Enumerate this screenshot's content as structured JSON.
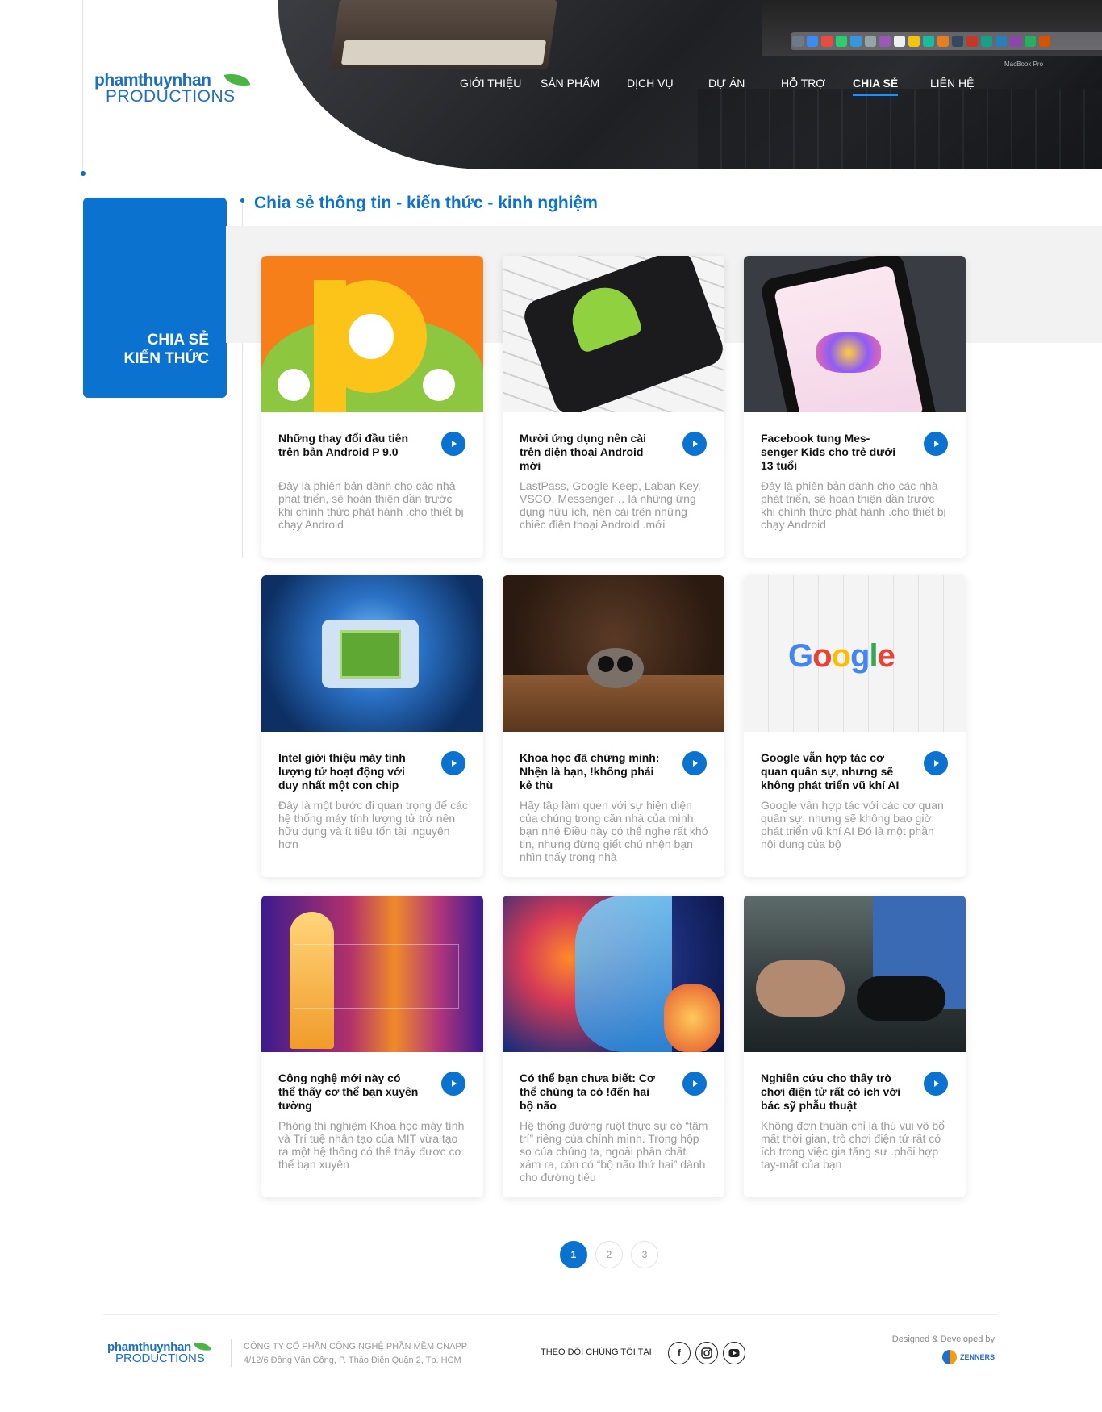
{
  "brand": {
    "logo_line1": "phamthuynhan",
    "logo_line2": "PRODUCTIONS"
  },
  "hero": {
    "device_label": "MacBook Pro"
  },
  "nav": {
    "items": [
      {
        "label": "GIỚI THIỆU"
      },
      {
        "label": "SẢN PHẨM"
      },
      {
        "label": "DỊCH VỤ"
      },
      {
        "label": "DỰ ÁN"
      },
      {
        "label": "HỖ TRỢ"
      },
      {
        "label": "CHIA SẺ",
        "active": true
      },
      {
        "label": "LIÊN HỆ"
      }
    ]
  },
  "sidebar": {
    "line1": "CHIA SẺ",
    "line2": "KIẾN THỨC"
  },
  "section": {
    "title": "Chia sẻ thông tin - kiến thức - kinh nghiệm"
  },
  "articles": [
    {
      "title": "Những thay đổi đầu tiên trên bản Android P 9.0",
      "desc": "Đây là phiên bản dành cho các nhà phát triển, sẽ hoàn thiện dần trước khi chính thức phát hành .cho thiết bị chạy Android",
      "image": "android-pie-image"
    },
    {
      "title": "Mười ứng dụng nên cài trên điện thoại Android mới",
      "desc": "LastPass, Google Keep, Laban Key, VSCO, Messenger… là những ứng dụng hữu ích, nên cài trên những chiếc điện thoại Android .mới",
      "image": "android-phone-image"
    },
    {
      "title": "Facebook tung Mes-senger Kids cho trẻ dưới 13 tuổi",
      "desc": "Đây là phiên bản dành cho các nhà phát triển, sẽ hoàn thiện dần trước khi chính thức phát hành .cho thiết bị chạy Android",
      "image": "messenger-kids-image"
    },
    {
      "title": "Intel giới thiệu máy tính lượng tử hoạt động với duy nhất một con chip",
      "desc": "Đây là một bước đi quan trọng để các hệ thống máy tính lượng tử trở nên hữu dụng và ít tiêu tốn tài .nguyên hơn",
      "image": "chip-image"
    },
    {
      "title": "Khoa học đã chứng minh: Nhện là bạn, !không phải kẻ thù",
      "desc": "Hãy tập làm quen với sự hiện diện của chúng trong căn nhà của mình bạn nhé Điều này có thể nghe rất khó tin, nhưng đừng giết chú nhện bạn nhìn thấy trong nhà",
      "image": "spider-image"
    },
    {
      "title": "Google vẫn hợp tác cơ quan quân sự, nhưng sẽ không phát triển vũ khí AI",
      "desc": "Google vẫn hợp tác với các cơ quan quân sự, nhưng sẽ không bao giờ phát triển vũ khí AI Đó là một phần nội dung của bộ",
      "image": "google-image"
    },
    {
      "title": "Công nghệ mới này có thể thấy cơ thể bạn xuyên tường",
      "desc": "Phòng thí nghiệm Khoa học máy tính và Trí tuệ nhân tạo của MIT vừa tạo ra một hệ thống có thể thấy được cơ thể bạn xuyên",
      "image": "thermal-image"
    },
    {
      "title": "Có thể bạn chưa biết: Cơ thể chúng ta có !đến hai bộ não",
      "desc": "Hệ thống đường ruột thực sự có “tâm trí” riêng của chính mình. Trong hộp sọ của chúng ta, ngoài phần chất xám ra, còn có “bộ não thứ hai” dành cho đường tiêu",
      "image": "brain-image"
    },
    {
      "title": "Nghiên cứu cho thấy trò chơi điện tử rất có ích với bác sỹ phẫu thuật",
      "desc": "Không đơn thuần chỉ là thú vui vô bổ mất thời gian, trò chơi điện tử rất có ích trong việc gia tăng sự .phối hợp tay-mắt của bạn",
      "image": "gamepad-image"
    }
  ],
  "google_word": "Google",
  "pagination": {
    "pages": [
      "1",
      "2",
      "3"
    ],
    "current": "1"
  },
  "footer": {
    "logo_line1": "phamthuynhan",
    "logo_line2": "PRODUCTIONS",
    "company": "CÔNG TY CỔ PHẦN CÔNG NGHỆ PHẦN MỀM CNAPP",
    "address": "4/12/6 Đồng Văn Cống, P. Thảo Điền Quận 2, Tp. HCM",
    "follow": "THEO DÕI CHÚNG TÔI TẠI",
    "social": [
      "facebook-icon",
      "instagram-icon",
      "youtube-icon"
    ],
    "designed_by": "Designed & Developed by",
    "developer": "ZENNERS"
  },
  "colors": {
    "primary": "#0b72d0",
    "leaf": "#4bb543"
  }
}
